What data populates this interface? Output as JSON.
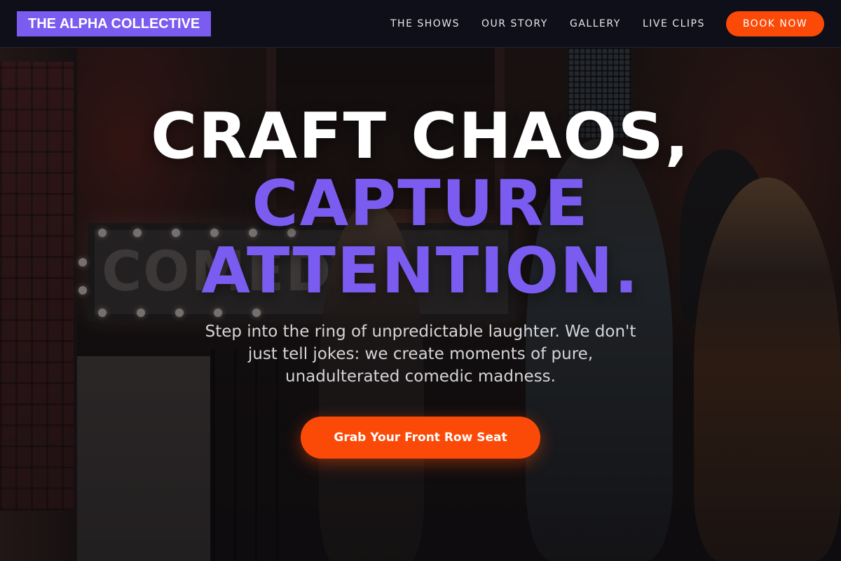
{
  "header": {
    "logo_text": "THE ALPHA COLLECTIVE",
    "nav": {
      "shows": "THE SHOWS",
      "story": "OUR STORY",
      "gallery": "GALLERY",
      "clips": "LIVE CLIPS"
    },
    "book_label": "BOOK NOW"
  },
  "hero": {
    "headline_line1": "CRAFT CHAOS,",
    "headline_line2": "CAPTURE",
    "headline_line3": "ATTENTION.",
    "subtitle": "Step into the ring of unpredictable laughter. We don't just tell jokes: we create moments of pure, unadulterated comedic madness.",
    "cta_label": "Grab Your Front Row Seat",
    "background_sign_text": "COMEDY"
  },
  "colors": {
    "accent_purple": "#7a5cf0",
    "accent_orange": "#fb4a08",
    "nav_background": "#0f0f19",
    "headline_white": "#ffffff"
  }
}
